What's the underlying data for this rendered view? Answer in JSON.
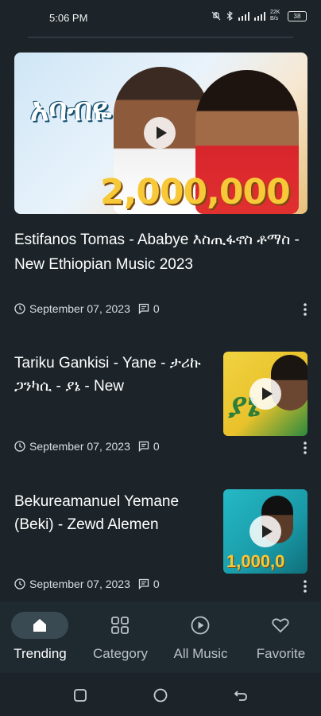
{
  "status_bar": {
    "time": "5:06 PM",
    "network_speed": "22K B/s",
    "battery": "38"
  },
  "feed": {
    "items": [
      {
        "title": "Estifanos Tomas - Ababye እስጢፋኖስ ቶማስ - New Ethiopian Music 2023",
        "date": "September 07, 2023",
        "comments": "0",
        "thumb_text": "አባብዬ",
        "thumb_views": "2,000,000"
      },
      {
        "title": "Tariku Gankisi - Yane - ታሪኩ ጋንካሲ - ያኔ - New",
        "date": "September 07, 2023",
        "comments": "0",
        "thumb_text": "ያኔ"
      },
      {
        "title": "Bekureamanuel Yemane (Beki) - Zewd Alemen",
        "date": "September 07, 2023",
        "comments": "0",
        "thumb_views": "1,000,0"
      }
    ]
  },
  "bottom_nav": {
    "items": [
      {
        "label": "Trending",
        "icon": "home-icon",
        "active": true
      },
      {
        "label": "Category",
        "icon": "grid-icon",
        "active": false
      },
      {
        "label": "All Music",
        "icon": "play-circle-icon",
        "active": false
      },
      {
        "label": "Favorite",
        "icon": "heart-icon",
        "active": false
      }
    ]
  },
  "colors": {
    "background": "#1c2429",
    "nav_background": "#1f2a30",
    "active_pill": "#3a4a53",
    "text": "#ffffff",
    "muted_text": "#b8c1c6"
  }
}
